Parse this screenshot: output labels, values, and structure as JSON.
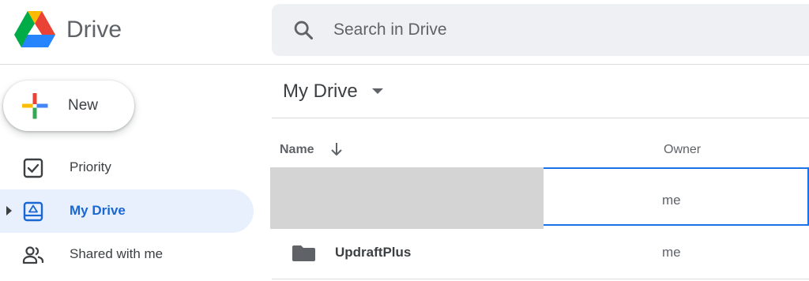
{
  "header": {
    "app_name": "Drive",
    "logo_icon": "google-drive-logo",
    "search": {
      "placeholder": "Search in Drive",
      "value": "",
      "icon": "search-icon"
    }
  },
  "sidebar": {
    "new_button": {
      "label": "New",
      "icon": "plus-icon"
    },
    "items": [
      {
        "label": "Priority",
        "icon": "checkbox-icon",
        "active": false
      },
      {
        "label": "My Drive",
        "icon": "my-drive-icon",
        "active": true,
        "expandable": true
      },
      {
        "label": "Shared with me",
        "icon": "people-icon",
        "active": false
      }
    ]
  },
  "main": {
    "title": "My Drive",
    "columns": {
      "name": "Name",
      "owner": "Owner",
      "sort": "descending"
    },
    "rows": [
      {
        "name": "",
        "owner": "me",
        "type": "redacted",
        "selected": true
      },
      {
        "name": "UpdraftPlus",
        "owner": "me",
        "type": "folder",
        "selected": false
      }
    ]
  },
  "colors": {
    "accent_blue": "#1a73e8",
    "active_bg": "#e8f0fe",
    "active_text": "#1967d2",
    "search_bg": "#eef0f3",
    "text_secondary": "#5f6368"
  }
}
